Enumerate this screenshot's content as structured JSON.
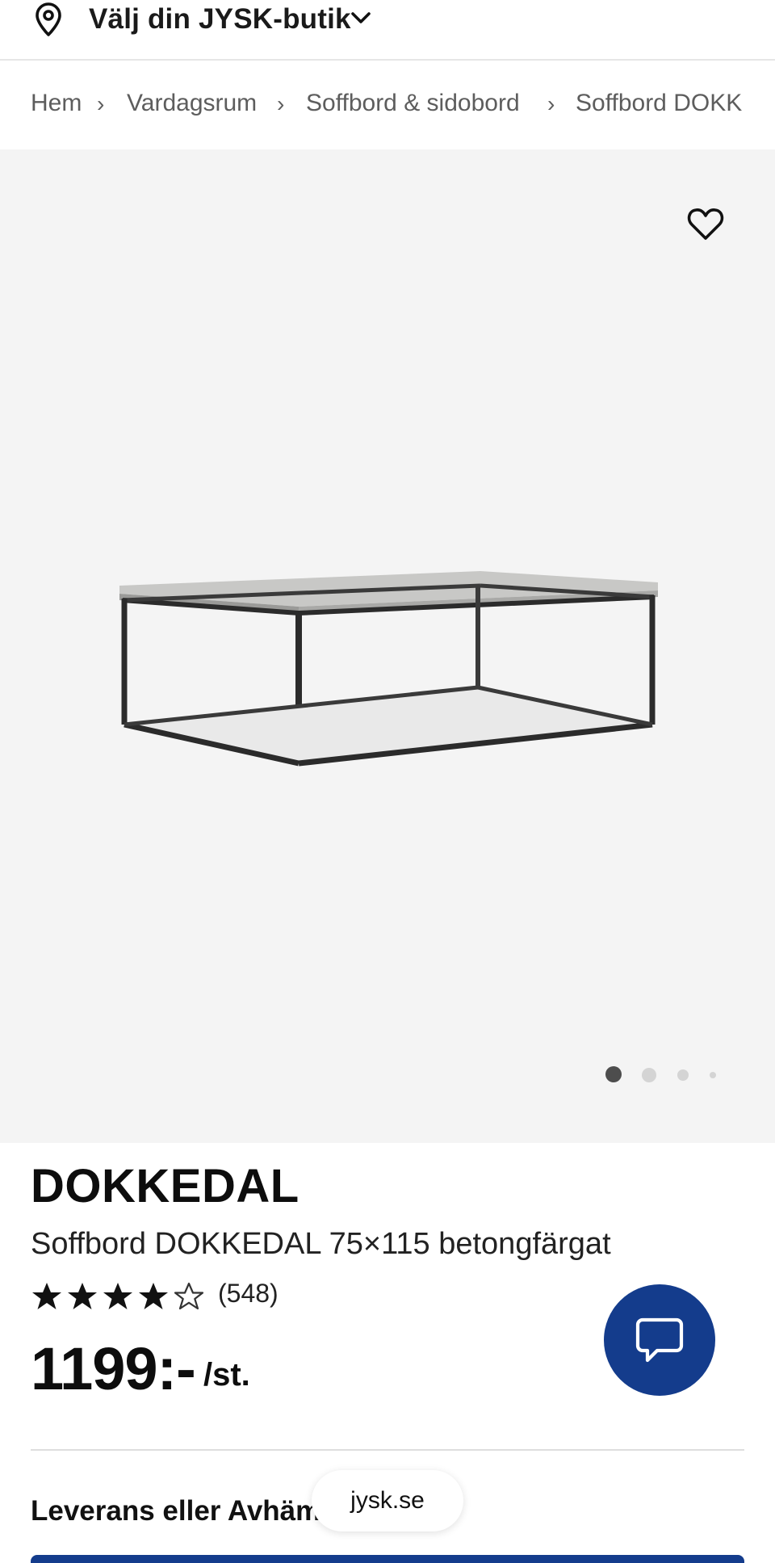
{
  "header": {
    "store_label": "Välj din JYSK-butik",
    "icons": {
      "location": "location-pin-icon",
      "dropdown": "chevron-down-icon"
    }
  },
  "breadcrumb": [
    "Hem",
    "Vardagsrum",
    "Soffbord & sidobord",
    "Soffbord DOKK"
  ],
  "breadcrumb_separator": "›",
  "gallery": {
    "image_count": 4,
    "active_index": 0,
    "favorite_icon": "heart-outline-icon"
  },
  "product": {
    "brand": "DOKKEDAL",
    "title": "Soffbord DOKKEDAL 75×115 betongfärgat",
    "rating": 4,
    "rating_max": 5,
    "reviews": "(548)",
    "price": "1199:-",
    "unit": "/st."
  },
  "chat": {
    "icon": "chat-bubble-icon"
  },
  "delivery": {
    "heading": "Leverans eller Avhämtning"
  },
  "browser": {
    "url": "jysk.se"
  },
  "colors": {
    "accent": "#143c8c",
    "gallery_bg": "#f4f4f4",
    "text": "#111111",
    "muted": "#5d5d5d"
  }
}
